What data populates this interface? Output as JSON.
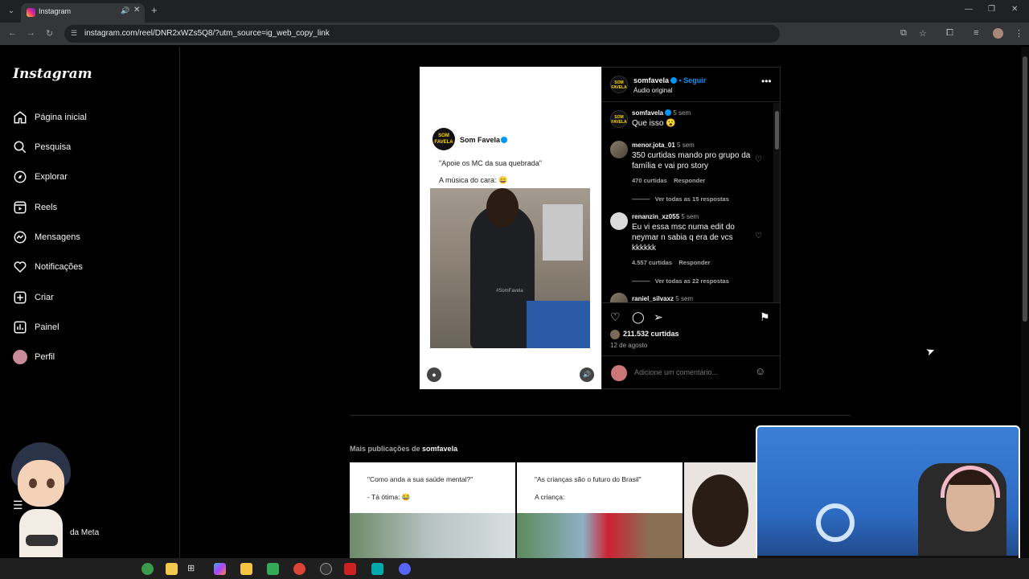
{
  "browser": {
    "tab_title": "Instagram",
    "url": "instagram.com/reel/DNR2xWZs5Q8/?utm_source=ig_web_copy_link"
  },
  "sidebar": {
    "logo": "Instagram",
    "items": [
      {
        "label": "Página inicial",
        "icon": "home-icon"
      },
      {
        "label": "Pesquisa",
        "icon": "search-icon"
      },
      {
        "label": "Explorar",
        "icon": "compass-icon"
      },
      {
        "label": "Reels",
        "icon": "reels-icon"
      },
      {
        "label": "Mensagens",
        "icon": "messenger-icon"
      },
      {
        "label": "Notificações",
        "icon": "heart-icon"
      },
      {
        "label": "Criar",
        "icon": "plus-square-icon"
      },
      {
        "label": "Painel",
        "icon": "dashboard-icon"
      },
      {
        "label": "Perfil",
        "icon": "profile-avatar"
      }
    ],
    "meta_label": "da Meta"
  },
  "video": {
    "account_name": "Som Favela",
    "logo_text": "SOM FAVELA",
    "quote": "\"Apoie os MC da sua quebrada\"",
    "subtitle": "A música do cara: 😄",
    "watermark": "#SomFavela"
  },
  "post": {
    "username": "somfavela",
    "follow_label": "• Seguir",
    "audio": "Áudio original",
    "comments": [
      {
        "user": "somfavela",
        "time": "5 sem",
        "text": "Que isso 😮"
      },
      {
        "user": "menor.jota_01",
        "time": "5 sem",
        "text": "350 curtidas mando pro grupo da família e vai pro story",
        "likes": "470 curtidas",
        "reply": "Responder",
        "view_replies": "Ver todas as 15 respostas"
      },
      {
        "user": "renanzin_xz055",
        "time": "5 sem",
        "text": "Eu vi essa msc numa edit do neymar n sabia q era de vcs kkkkkk",
        "likes": "4.557 curtidas",
        "reply": "Responder",
        "view_replies": "Ver todas as 22 respostas"
      },
      {
        "user": "raniel_silvaxz",
        "time": "5 sem"
      }
    ],
    "likes_count": "211.532 curtidas",
    "date": "12 de agosto",
    "comment_placeholder": "Adicione um comentário..."
  },
  "more_posts": {
    "prefix": "Mais publicações de",
    "user": "somfavela",
    "thumbs": [
      {
        "line1": "\"Como anda a sua saúde mental?\"",
        "line2": "- Tá ótima: 😂"
      },
      {
        "line1": "\"As crianças são o futuro do Brasil\"",
        "line2": "A criança:"
      }
    ]
  }
}
